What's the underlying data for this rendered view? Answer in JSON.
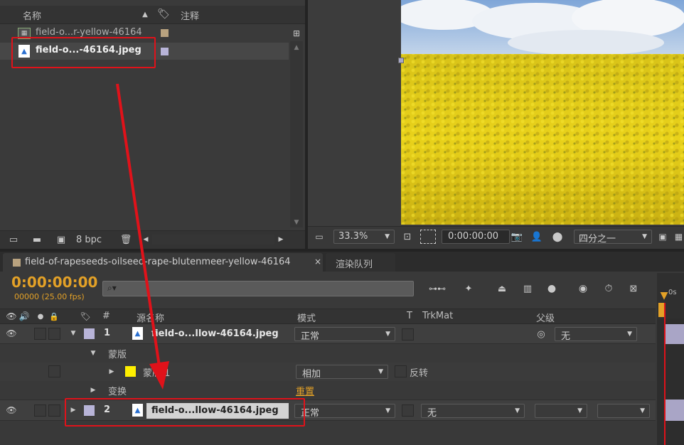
{
  "project": {
    "col_name": "名称",
    "col_comment": "注释",
    "items": [
      {
        "name": "field-o...r-yellow-46164"
      },
      {
        "name": "field-o...-46164.jpeg"
      }
    ],
    "bpc_label": "8 bpc"
  },
  "viewer": {
    "zoom": "33.3%",
    "timecode": "0:00:00:00",
    "resolution": "四分之一"
  },
  "tabs": [
    {
      "label": "field-of-rapeseeds-oilseed-rape-blutenmeer-yellow-46164"
    },
    {
      "label": "渲染队列"
    }
  ],
  "timeline": {
    "timecode": "0:00:00:00",
    "frame_info": "00000 (25.00 fps)",
    "search_placeholder": "",
    "headers": {
      "hash": "#",
      "source_name": "源名称",
      "mode": "模式",
      "t": "T",
      "trkmat": "TrkMat",
      "parent": "父级"
    },
    "ruler_label": "0s",
    "layers": [
      {
        "index": "1",
        "name": "field-o...llow-46164.jpeg",
        "mode": "正常",
        "parent": "无",
        "color": "#b8b4d8"
      },
      {
        "index": "2",
        "name": "field-o...llow-46164.jpeg",
        "mode": "正常",
        "trkmat": "无",
        "color": "#b8b4d8"
      }
    ],
    "mask_group": "蒙版",
    "mask_name": "蒙版 1",
    "mask_mode": "相加",
    "invert_label": "反转",
    "transform_label": "变换",
    "reset_label": "重置"
  },
  "colors": {
    "accent_orange": "#e3a127",
    "highlight_red": "#e0121a",
    "layer_label": "#b8b4d8",
    "mask_yellow": "#ffef00"
  }
}
